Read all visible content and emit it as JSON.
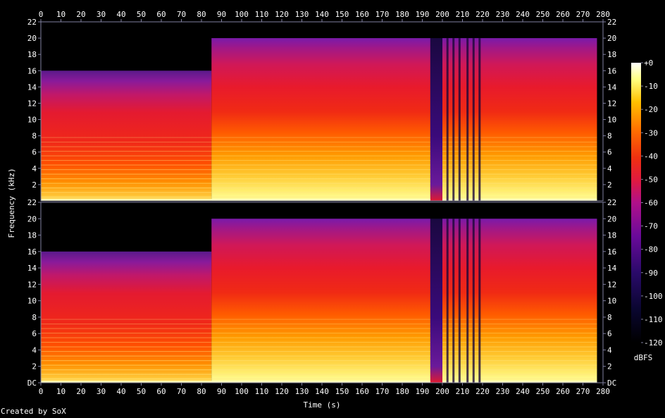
{
  "credit": "Created by SoX",
  "chart_data": {
    "type": "heatmap",
    "title": "",
    "xlabel": "Time (s)",
    "ylabel": "Frequency (kHz)",
    "x_ticks": [
      "0",
      "10",
      "20",
      "30",
      "40",
      "50",
      "60",
      "70",
      "80",
      "90",
      "100",
      "110",
      "120",
      "130",
      "140",
      "150",
      "160",
      "170",
      "180",
      "190",
      "200",
      "210",
      "220",
      "230",
      "240",
      "250",
      "260",
      "270",
      "280"
    ],
    "y_ticks_channel_top": [
      "22",
      "20",
      "18",
      "16",
      "14",
      "12",
      "10",
      "8",
      "6",
      "4",
      "2"
    ],
    "y_ticks_channel_bottom": [
      "22",
      "20",
      "18",
      "16",
      "14",
      "12",
      "10",
      "8",
      "6",
      "4",
      "2",
      "DC"
    ],
    "xlim": [
      0,
      280
    ],
    "ylim_khz": [
      0,
      22
    ],
    "colorbar": {
      "label": "dBFS",
      "ticks": [
        "+0",
        "-10",
        "-20",
        "-30",
        "-40",
        "-50",
        "-60",
        "-70",
        "-80",
        "-90",
        "-100",
        "-110",
        "-120"
      ],
      "range": [
        -120,
        0
      ]
    },
    "channels": 2,
    "segments": [
      {
        "start_s": 0,
        "end_s": 85,
        "cutoff_khz": 16
      },
      {
        "start_s": 85,
        "end_s": 194,
        "cutoff_khz": 20
      },
      {
        "start_s": 194,
        "end_s": 200,
        "cutoff_khz": 0
      },
      {
        "start_s": 200,
        "end_s": 220,
        "cutoff_khz": 20
      },
      {
        "start_s": 220,
        "end_s": 277,
        "cutoff_khz": 20
      }
    ]
  }
}
